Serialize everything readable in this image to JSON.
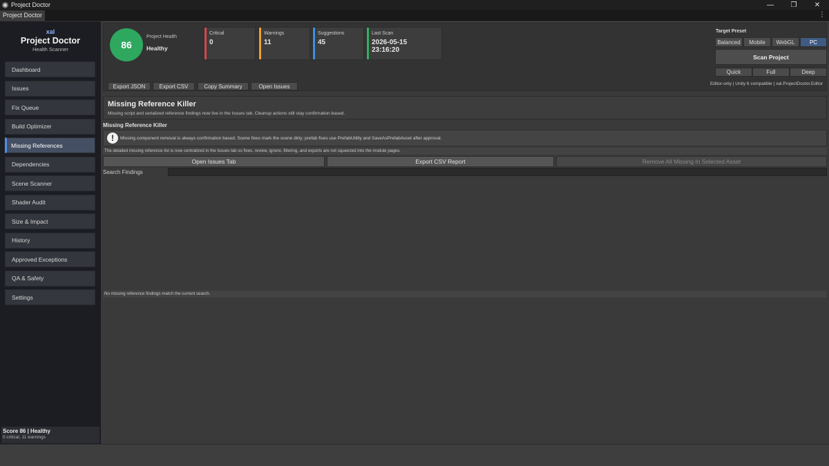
{
  "window": {
    "title": "Project Doctor",
    "controls": {
      "minimize": "—",
      "maximize": "❐",
      "close": "✕"
    }
  },
  "tab": {
    "label": "Project Doctor",
    "menu_glyph": "⋮"
  },
  "sidebar": {
    "brand_eyebrow": "xal",
    "brand_name": "Project Doctor",
    "brand_sub": "Health Scanner",
    "items": [
      {
        "label": "Dashboard"
      },
      {
        "label": "Issues"
      },
      {
        "label": "Fix Queue"
      },
      {
        "label": "Build Optimizer"
      },
      {
        "label": "Missing References",
        "active": true
      },
      {
        "label": "Dependencies"
      },
      {
        "label": "Scene Scanner"
      },
      {
        "label": "Shader Audit"
      },
      {
        "label": "Size & Impact"
      },
      {
        "label": "History"
      },
      {
        "label": "Approved Exceptions"
      },
      {
        "label": "QA & Safety"
      },
      {
        "label": "Settings"
      }
    ],
    "score_line": "Score 86 | Healthy",
    "score_sub": "0 critical, 11 warnings"
  },
  "header": {
    "health_score": "86",
    "health_label": "Project Health",
    "health_status": "Healthy",
    "stats": {
      "critical": {
        "label": "Critical",
        "value": "0"
      },
      "warnings": {
        "label": "Warnings",
        "value": "11"
      },
      "suggestions": {
        "label": "Suggestions",
        "value": "45"
      },
      "last_scan": {
        "label": "Last Scan",
        "value": "2026-05-15 23:16:20"
      }
    },
    "export_buttons": {
      "json": "Export JSON",
      "csv": "Export CSV",
      "copy": "Copy Summary",
      "open": "Open Issues"
    },
    "target_preset": {
      "title": "Target Preset",
      "options": [
        "Balanced",
        "Mobile",
        "WebGL",
        "PC"
      ],
      "selected": "PC"
    },
    "scan_button": "Scan Project",
    "scan_modes": [
      "Quick",
      "Full",
      "Deep"
    ],
    "editor_note": "Editor-only | Unity 6 compatible | xal.ProjectDoctor.Editor"
  },
  "module": {
    "title": "Missing Reference Killer",
    "description": "Missing script and serialized reference findings now live in the Issues tab. Cleanup actions still stay confirmation-based.",
    "section_title": "Missing Reference Killer",
    "info_text": "Missing component removal is always confirmation based. Scene fixes mark the scene dirty; prefab fixes use PrefabUtility and SaveAsPrefabAsset after approval.",
    "centralized_note": "The detailed missing reference list is now centralized in the Issues tab so fixes, review, ignore, filtering, and exports are not squeezed into the module pages.",
    "actions": {
      "open_issues": "Open Issues Tab",
      "export_csv": "Export CSV Report",
      "remove_all": "Remove All Missing In Selected Asset"
    },
    "search_label": "Search Findings",
    "search_value": "",
    "empty_message": "No missing reference findings match the current search."
  },
  "colors": {
    "health": "#2fa85f",
    "critical": "#d9474c",
    "warnings": "#f0a030",
    "suggestions": "#3f8fe0",
    "last_scan": "#37b15c",
    "accent": "#4f8ee8"
  }
}
